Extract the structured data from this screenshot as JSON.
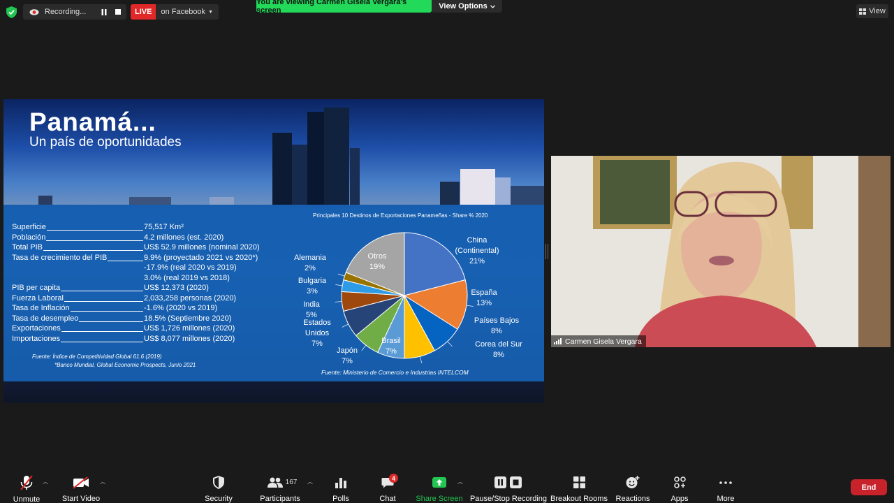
{
  "topbar": {
    "recording_label": "Recording...",
    "live_label": "LIVE",
    "live_target": "on Facebook",
    "viewing_banner": "You are viewing Carmen Gisela Vergara's screen",
    "view_options_label": "View Options",
    "view_label": "View"
  },
  "slide": {
    "title": "Panamá...",
    "subtitle": "Un país de oportunidades",
    "stats": [
      {
        "label": "Superficie",
        "value": "75,517 Km²"
      },
      {
        "label": "Población",
        "value": "4.2 millones (est. 2020)"
      },
      {
        "label": "Total PIB",
        "value": "US$ 52.9 millones (nominal 2020)"
      },
      {
        "label": "Tasa de crecimiento del PIB",
        "value": "9.9% (proyectado 2021 vs 2020*)"
      },
      {
        "label": "",
        "value": "-17.9% (real 2020 vs 2019)"
      },
      {
        "label": "",
        "value": "3.0% (real 2019 vs 2018)"
      },
      {
        "label": "PIB per capita",
        "value": "US$ 12,373 (2020)"
      },
      {
        "label": "Fuerza Laboral",
        "value": "2,033,258 personas (2020)"
      },
      {
        "label": "Tasa de Inflación",
        "value": "-1.6% (2020 vs 2019)"
      },
      {
        "label": "Tasa de desempleo",
        "value": "18.5%  (Septiembre 2020)"
      },
      {
        "label": "Exportaciones",
        "value": "US$ 1,726 millones (2020)"
      },
      {
        "label": "Importaciones",
        "value": "US$ 8,077 millones (2020)"
      }
    ],
    "footnote_1": "Fuente:  Índice de Competitividad Global  61.6 (2019)",
    "footnote_2": "*Banco Mundial, Global Economic Prospects, Junio 2021"
  },
  "chart_data": {
    "type": "pie",
    "title": "Principales 10 Destinos de Exportaciones Panameñas - Share % 2020",
    "source": "Fuente: Ministerio de Comercio e Industrias INTELCOM",
    "categories": [
      "China (Continental)",
      "España",
      "Países Bajos",
      "Corea del Sur",
      "Brasil",
      "Japón",
      "Estados Unidos",
      "India",
      "Bulgaria",
      "Alemania",
      "Otros"
    ],
    "values": [
      21,
      13,
      8,
      8,
      7,
      7,
      7,
      5,
      3,
      2,
      19
    ],
    "labels": [
      {
        "name": "China\n(Continental)",
        "pct": "21%"
      },
      {
        "name": "España",
        "pct": "13%"
      },
      {
        "name": "Países Bajos",
        "pct": "8%"
      },
      {
        "name": "Corea del Sur",
        "pct": "8%"
      },
      {
        "name": "Brasil",
        "pct": "7%"
      },
      {
        "name": "Japón",
        "pct": "7%"
      },
      {
        "name": "Estados\nUnidos",
        "pct": "7%"
      },
      {
        "name": "India",
        "pct": "5%"
      },
      {
        "name": "Bulgaria",
        "pct": "3%"
      },
      {
        "name": "Alemania",
        "pct": "2%"
      },
      {
        "name": "Otros",
        "pct": "19%"
      }
    ],
    "colors": [
      "#4472c4",
      "#ed7d31",
      "#0563c1",
      "#ffc000",
      "#5b9bd5",
      "#70ad47",
      "#264478",
      "#9e480e",
      "#2e9be6",
      "#997300",
      "#a5a5a5"
    ]
  },
  "participant": {
    "name": "Carmen Gisela Vergara"
  },
  "toolbar": {
    "unmute": "Unmute",
    "start_video": "Start Video",
    "security": "Security",
    "participants": "Participants",
    "participants_count": "167",
    "polls": "Polls",
    "chat": "Chat",
    "chat_badge": "4",
    "share_screen": "Share Screen",
    "pause_stop_recording": "Pause/Stop Recording",
    "breakout_rooms": "Breakout Rooms",
    "reactions": "Reactions",
    "apps": "Apps",
    "more": "More",
    "end": "End"
  }
}
